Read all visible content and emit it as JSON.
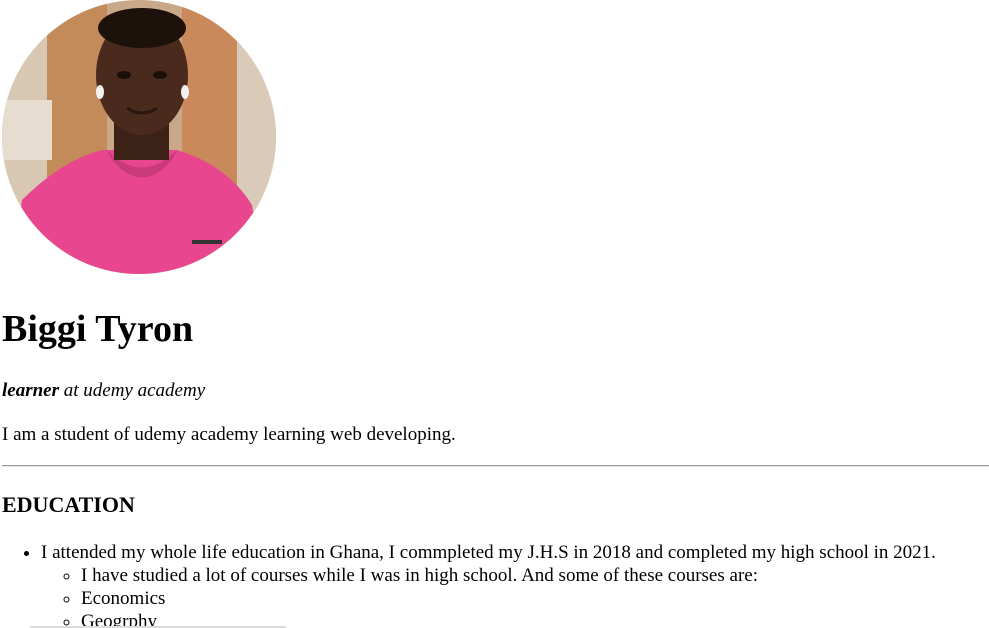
{
  "profile": {
    "photo_alt": "profile photo",
    "name": "Biggi Tyron",
    "role_strong": "learner",
    "role_rest": " at udemy academy",
    "bio": "I am a student of udemy academy learning web developing."
  },
  "education": {
    "title": "EDUCATION",
    "item_main": "I attended my whole life education in Ghana, I commpleted my J.H.S in 2018 and completed my high school in 2021.",
    "sub_items": [
      "I have studied a lot of courses while I was in high school. And some of these courses are:",
      "Economics",
      "Geogrphy"
    ]
  }
}
